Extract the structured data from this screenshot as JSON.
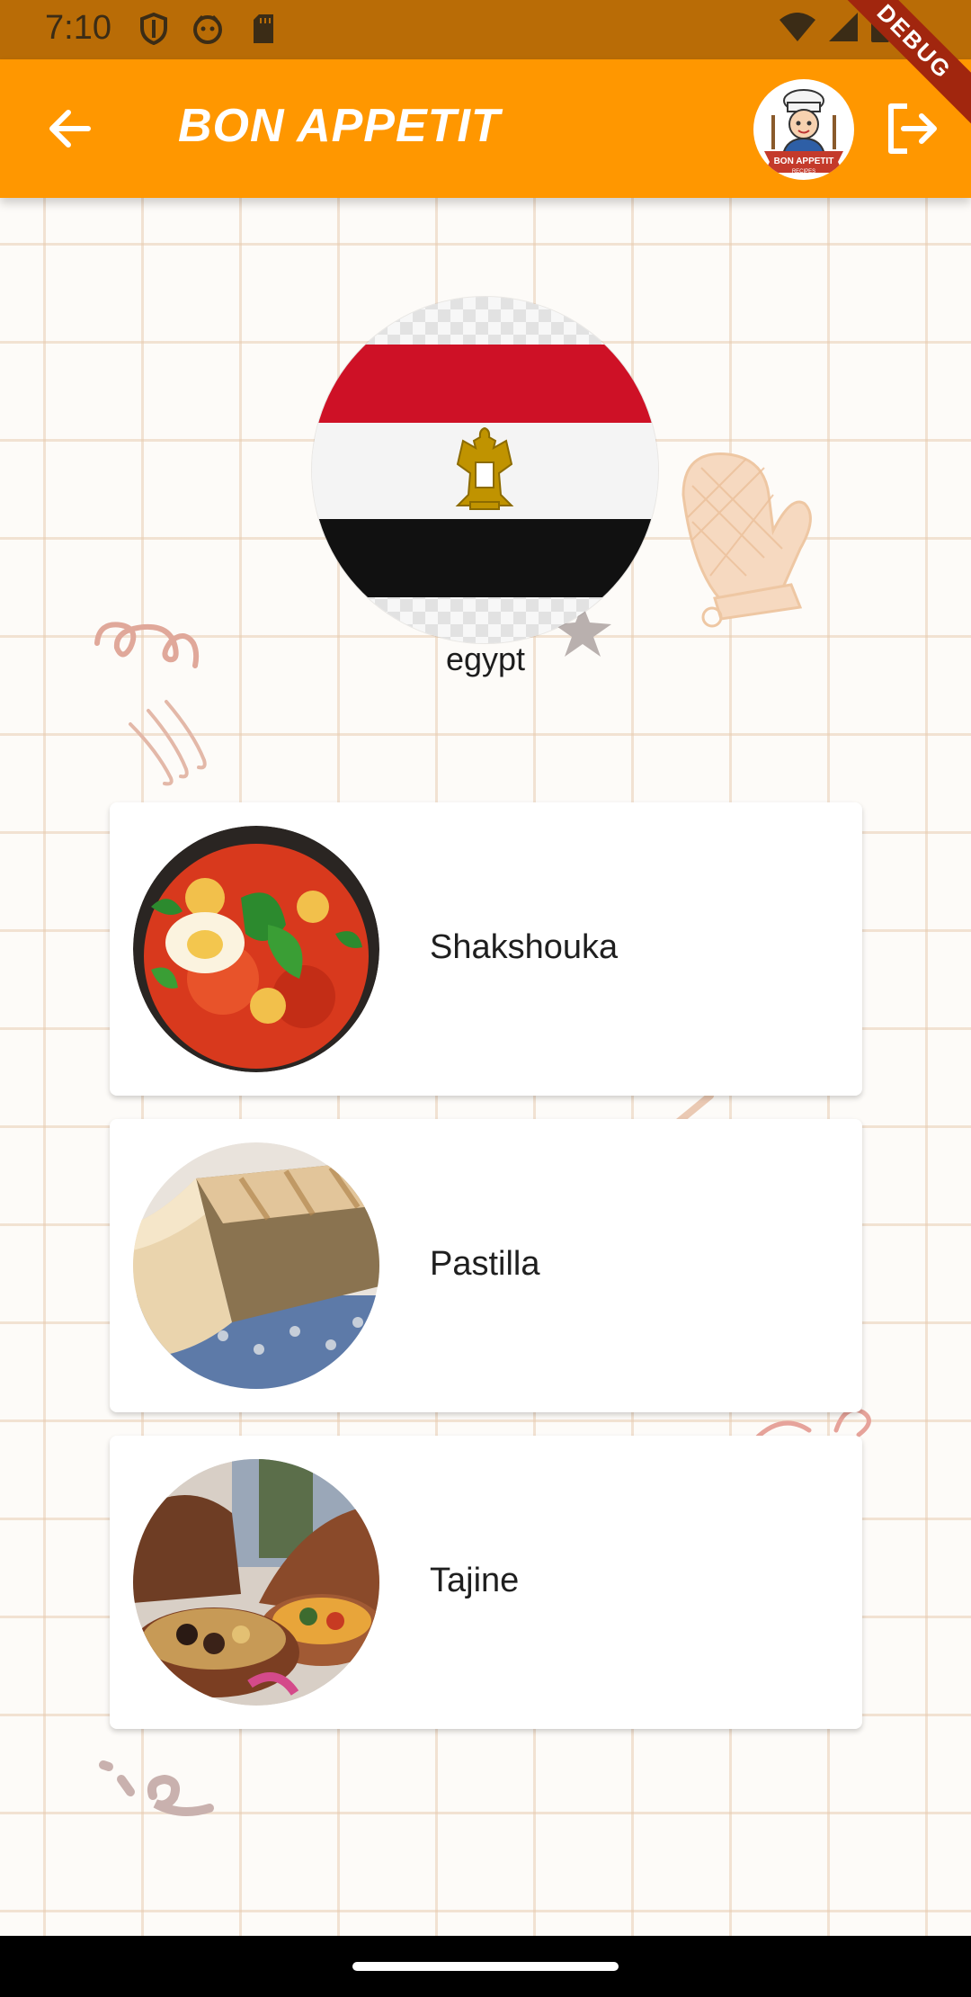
{
  "status_bar": {
    "time": "7:10"
  },
  "app_bar": {
    "title": "BON APPETIT",
    "logo_text": "BON APPETIT",
    "logo_subtext": "RECIPES"
  },
  "debug_banner": "DEBUG",
  "country": {
    "name": "egypt",
    "flag_colors": {
      "red": "#ce1126",
      "white": "#ffffff",
      "black": "#111111",
      "emblem": "#c09300"
    }
  },
  "meals": [
    {
      "name": "Shakshouka",
      "image": "shakshouka-photo"
    },
    {
      "name": "Pastilla",
      "image": "pastilla-photo"
    },
    {
      "name": "Tajine",
      "image": "tajine-photo"
    }
  ],
  "colors": {
    "primary": "#ff9700",
    "status_bar": "#b96c06",
    "debug": "#a1260e"
  }
}
